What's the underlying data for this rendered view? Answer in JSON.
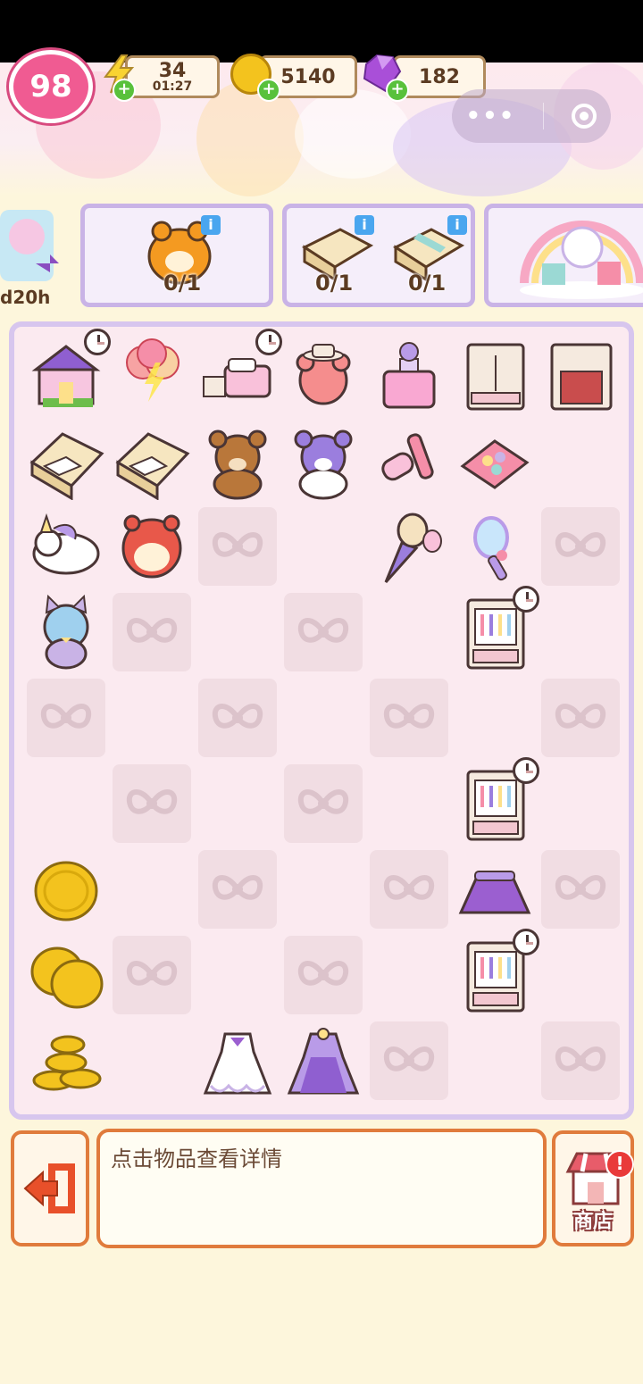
{
  "header": {
    "level": "98",
    "energy": {
      "value": "34",
      "timer": "01:27"
    },
    "coins": {
      "value": "5140"
    },
    "gems": {
      "value": "182"
    }
  },
  "orders": {
    "left_timer": "d20h",
    "order1": {
      "count": "0/1"
    },
    "order2": {
      "counts": [
        "0/1",
        "0/1"
      ]
    }
  },
  "board": {
    "columns": 7,
    "rows": 9,
    "items": [
      {
        "row": 0,
        "col": 0,
        "name": "dollhouse-icon",
        "timer": true
      },
      {
        "row": 0,
        "col": 1,
        "name": "balloon-generator-icon",
        "timer": false
      },
      {
        "row": 0,
        "col": 2,
        "name": "pink-bed-set-icon",
        "timer": true
      },
      {
        "row": 0,
        "col": 3,
        "name": "pink-bear-hat-icon",
        "timer": false
      },
      {
        "row": 0,
        "col": 4,
        "name": "perfume-bottle-icon",
        "timer": false
      },
      {
        "row": 0,
        "col": 5,
        "name": "wardrobe-icon",
        "timer": false
      },
      {
        "row": 0,
        "col": 6,
        "name": "nightstand-icon",
        "timer": false
      },
      {
        "row": 1,
        "col": 0,
        "name": "gift-box-icon",
        "timer": false
      },
      {
        "row": 1,
        "col": 1,
        "name": "gift-box-icon",
        "timer": false
      },
      {
        "row": 1,
        "col": 2,
        "name": "brown-teddy-bear-icon",
        "timer": false
      },
      {
        "row": 1,
        "col": 3,
        "name": "purple-teddy-bear-icon",
        "timer": false
      },
      {
        "row": 1,
        "col": 4,
        "name": "lip-gloss-icon",
        "timer": false
      },
      {
        "row": 1,
        "col": 5,
        "name": "eyeshadow-palette-icon",
        "timer": false
      },
      {
        "row": 2,
        "col": 0,
        "name": "unicorn-plush-icon",
        "timer": false
      },
      {
        "row": 2,
        "col": 1,
        "name": "hamster-plush-icon",
        "timer": false
      },
      {
        "row": 2,
        "col": 4,
        "name": "makeup-brush-icon",
        "timer": false
      },
      {
        "row": 2,
        "col": 5,
        "name": "hand-mirror-icon",
        "timer": false
      },
      {
        "row": 3,
        "col": 0,
        "name": "cat-plush-icon",
        "timer": false
      },
      {
        "row": 3,
        "col": 5,
        "name": "open-wardrobe-icon",
        "timer": true
      },
      {
        "row": 5,
        "col": 5,
        "name": "open-wardrobe-icon",
        "timer": true
      },
      {
        "row": 6,
        "col": 0,
        "name": "coin-icon",
        "timer": false
      },
      {
        "row": 6,
        "col": 5,
        "name": "purple-skirt-icon",
        "timer": false
      },
      {
        "row": 7,
        "col": 0,
        "name": "two-coins-icon",
        "timer": false
      },
      {
        "row": 7,
        "col": 5,
        "name": "open-wardrobe-icon",
        "timer": true
      },
      {
        "row": 8,
        "col": 0,
        "name": "coin-stack-icon",
        "timer": false
      },
      {
        "row": 8,
        "col": 2,
        "name": "white-dress-icon",
        "timer": false
      },
      {
        "row": 8,
        "col": 3,
        "name": "purple-dress-icon",
        "timer": false
      }
    ],
    "bow_slots": [
      [
        2,
        2
      ],
      [
        2,
        6
      ],
      [
        3,
        1
      ],
      [
        3,
        3
      ],
      [
        4,
        0
      ],
      [
        4,
        2
      ],
      [
        4,
        4
      ],
      [
        4,
        6
      ],
      [
        5,
        1
      ],
      [
        5,
        3
      ],
      [
        6,
        2
      ],
      [
        6,
        4
      ],
      [
        6,
        6
      ],
      [
        7,
        1
      ],
      [
        7,
        3
      ],
      [
        8,
        4
      ],
      [
        8,
        6
      ]
    ],
    "empty_slots": [
      [
        1,
        6
      ],
      [
        2,
        3
      ],
      [
        3,
        2
      ],
      [
        3,
        6
      ],
      [
        4,
        1
      ],
      [
        4,
        3
      ],
      [
        4,
        5
      ],
      [
        5,
        0
      ],
      [
        5,
        2
      ],
      [
        5,
        4
      ],
      [
        5,
        6
      ],
      [
        6,
        1
      ],
      [
        6,
        3
      ],
      [
        7,
        2
      ],
      [
        7,
        4
      ],
      [
        7,
        6
      ],
      [
        8,
        1
      ],
      [
        8,
        5
      ]
    ]
  },
  "bottom": {
    "detail_text": "点击物品查看详情",
    "shop_label": "商店",
    "shop_alert": "!"
  },
  "colors": {
    "board_bg": "#fbeaf0",
    "board_border": "#d7c6ee",
    "slot_bg": "#f1dde3",
    "accent_orange": "#e07b3c",
    "level_pink": "#f05b92"
  }
}
